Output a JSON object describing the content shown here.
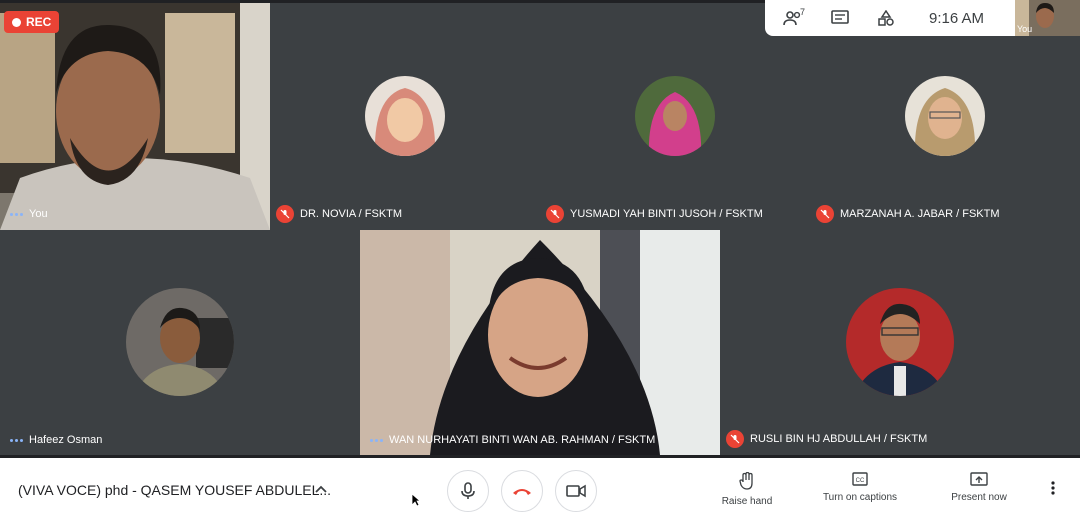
{
  "recording": {
    "label": "REC"
  },
  "topbar": {
    "people_count": "7",
    "time": "9:16 AM",
    "self_label": "You"
  },
  "tiles": {
    "self": {
      "name": "You"
    },
    "t1": {
      "name": "DR. NOVIA / FSKTM"
    },
    "t2": {
      "name": "YUSMADI YAH BINTI JUSOH / FSKTM"
    },
    "t3": {
      "name": "MARZANAH A. JABAR / FSKTM"
    },
    "t4": {
      "name": "Hafeez Osman"
    },
    "t5": {
      "name": "WAN NURHAYATI BINTI WAN AB. RAHMAN / FSKTM"
    },
    "t6": {
      "name": "RUSLI BIN HJ ABDULLAH / FSKTM"
    }
  },
  "bottombar": {
    "meeting_title": "(VIVA VOCE) phd - QASEM YOUSEF ABDULEL...",
    "raise_hand": "Raise hand",
    "captions": "Turn on captions",
    "present": "Present now"
  },
  "colors": {
    "accent_red": "#ea4335",
    "tile_bg": "#3c4043",
    "stage_bg": "#202124"
  }
}
